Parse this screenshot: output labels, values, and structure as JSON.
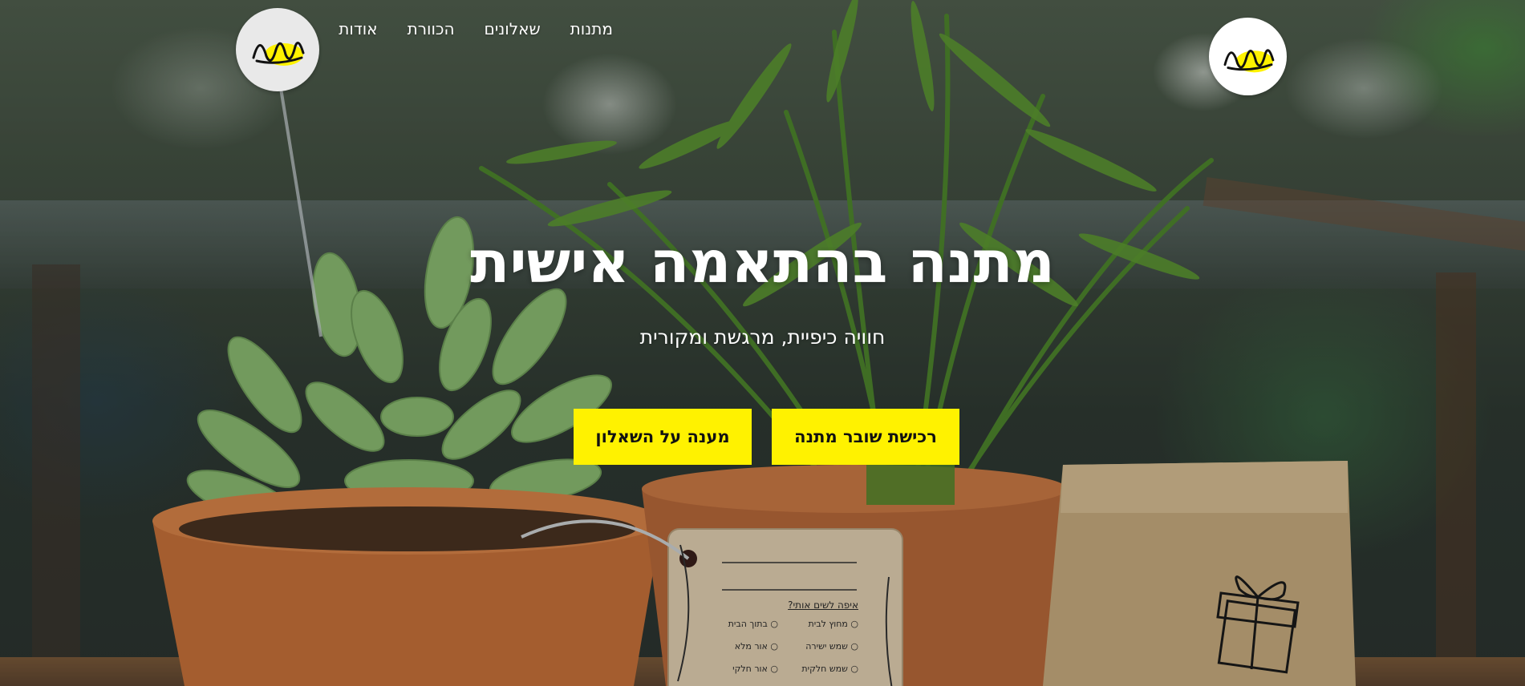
{
  "header": {
    "nav": [
      {
        "label": "אודות"
      },
      {
        "label": "הכוורת"
      },
      {
        "label": "שאלונים"
      },
      {
        "label": "מתנות"
      }
    ],
    "logo_icon": "bee-logo-icon"
  },
  "hero": {
    "title": "מתנה בהתאמה אישית",
    "subtitle": "חוויה כיפיית, מרגשת ומקורית",
    "buttons": {
      "buy_voucher": "רכישת שובר מתנה",
      "answer_questionnaire": "מענה על השאלון"
    }
  },
  "card": {
    "heading": "איפה לשים אותי?",
    "options": [
      "מחוץ לבית",
      "בתוך הבית",
      "שמש ישירה",
      "אור מלא",
      "שמש חלקית",
      "אור חלקי"
    ]
  },
  "colors": {
    "accent": "#fff200",
    "text_light": "#ffffff",
    "button_text": "#111111"
  }
}
